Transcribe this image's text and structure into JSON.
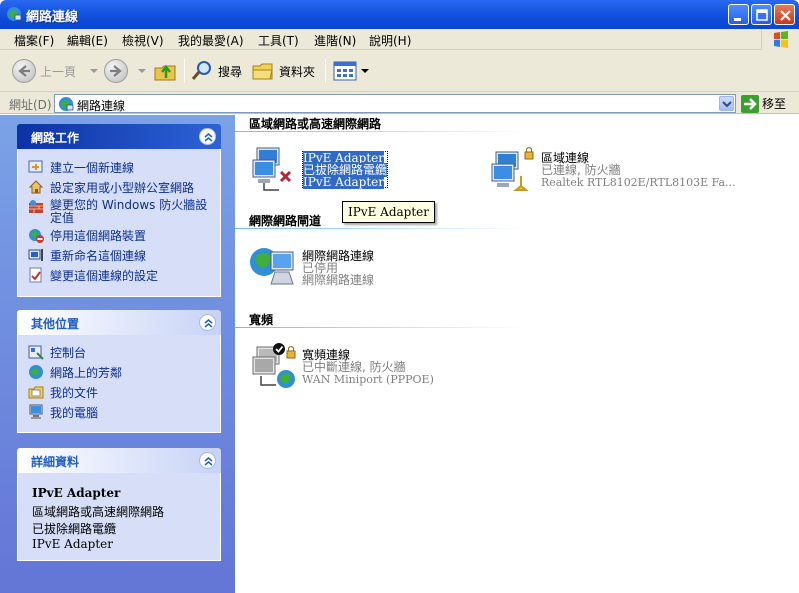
{
  "window": {
    "title": "網路連線",
    "buttons": [
      "minimize",
      "maximize",
      "close"
    ]
  },
  "menu": {
    "items": [
      "檔案(F)",
      "編輯(E)",
      "檢視(V)",
      "我的最愛(A)",
      "工具(T)",
      "進階(N)",
      "說明(H)"
    ]
  },
  "toolbar": {
    "back_label": "上一頁",
    "search_label": "搜尋",
    "folders_label": "資料夾"
  },
  "address": {
    "label": "網址(D)",
    "value": "網路連線",
    "go_label": "移至"
  },
  "left_pane": {
    "network_tasks": {
      "title": "網路工作",
      "items": [
        {
          "label": "建立一個新連線",
          "icon": "new-connection-icon"
        },
        {
          "label": "設定家用或小型辦公室網路",
          "icon": "home-network-icon"
        },
        {
          "label": "變更您的 Windows 防火牆設定值",
          "icon": "firewall-icon"
        },
        {
          "label": "停用這個網路裝置",
          "icon": "disable-device-icon"
        },
        {
          "label": "重新命名這個連線",
          "icon": "rename-icon"
        },
        {
          "label": "變更這個連線的設定",
          "icon": "settings-icon"
        }
      ]
    },
    "other_places": {
      "title": "其他位置",
      "items": [
        {
          "label": "控制台",
          "icon": "control-panel-icon"
        },
        {
          "label": "網路上的芳鄰",
          "icon": "network-places-icon"
        },
        {
          "label": "我的文件",
          "icon": "my-documents-icon"
        },
        {
          "label": "我的電腦",
          "icon": "my-computer-icon"
        }
      ]
    },
    "details": {
      "title": "詳細資料",
      "name": "IPvE Adapter",
      "lines": [
        "區域網路或高速網際網路",
        "已拔除網路電纜",
        "IPvE Adapter"
      ]
    }
  },
  "content": {
    "sections": [
      {
        "title": "區域網路或高速網際網路",
        "connections": [
          {
            "name": "IPvE Adapter",
            "status": "已拔除網路電纜",
            "device": "IPvE Adapter",
            "selected": true
          },
          {
            "name": "區域連線",
            "status": "已連線, 防火牆",
            "device": "Realtek RTL8102E/RTL8103E Fa...",
            "selected": false
          }
        ]
      },
      {
        "title": "網際網路閘道",
        "connections": [
          {
            "name": "網際網路連線",
            "status": "已停用",
            "device": "網際網路連線",
            "selected": false
          }
        ]
      },
      {
        "title": "寬頻",
        "connections": [
          {
            "name": "寬頻連線",
            "status": "已中斷連線, 防火牆",
            "device": "WAN Miniport (PPPOE)",
            "selected": false
          }
        ]
      }
    ],
    "tooltip": "IPvE Adapter"
  },
  "colors": {
    "titlebar": "#0a47ce",
    "pane_bg": "#6f8ddd",
    "panel_bg": "#d6dff7",
    "link": "#0c2e92",
    "selection": "#316ac5"
  }
}
